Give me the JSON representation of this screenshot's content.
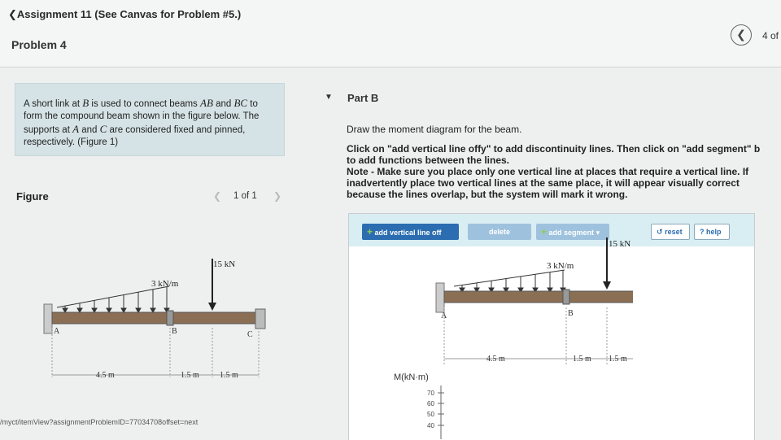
{
  "header": {
    "breadcrumb": "❮Assignment 11 (See Canvas for Problem #5.)",
    "problem_title": "Problem 4",
    "nav_prev_glyph": "❮",
    "page_count": "4 of"
  },
  "statement": {
    "t1": "A short link at ",
    "v_B": "B",
    "t2": " is used to connect beams ",
    "v_AB": "AB",
    "t3": " and ",
    "v_BC": "BC",
    "t4": " to form the compound beam shown in the figure below. The supports at ",
    "v_A": "A",
    "t5": " and ",
    "v_C": "C",
    "t6": " are considered fixed and pinned, respectively. ",
    "link": "(Figure 1)"
  },
  "figure": {
    "label": "Figure",
    "prev": "❮",
    "page": "1 of 1",
    "next": "❯"
  },
  "beam_labels": {
    "point_load": "15 kN",
    "dist_load": "3 kN/m",
    "A": "A",
    "B": "B",
    "C": "C",
    "dim_45": "4.5 m",
    "dim_15a": "1.5 m",
    "dim_15b": "1.5 m"
  },
  "url": "/myct/itemView?assignmentProblemID=77034708offset=next",
  "part": {
    "toggle": "▼",
    "title": "Part B",
    "instruction1": "Draw the moment diagram for the beam.",
    "instruction2_lines": [
      "Click on \"add vertical line offy\" to add discontinuity lines. Then click on \"add segment\" b",
      "to add functions between the lines.",
      "Note - Make sure you place only one vertical line at places that require a vertical line. If",
      "inadvertently place two vertical lines at the same place, it will appear visually correct",
      "because the lines overlap, but the system will mark it wrong."
    ]
  },
  "toolbar": {
    "plus": "+",
    "add_line": "add vertical line off",
    "delete": "delete",
    "add_segment": "add segment",
    "dropdown": "▾",
    "reset_icon": "↺",
    "reset": "reset",
    "help_icon": "?",
    "help": "help"
  },
  "moment_axis": {
    "label": "M(kN·m)",
    "ticks": [
      "70",
      "60",
      "50",
      "40"
    ]
  }
}
